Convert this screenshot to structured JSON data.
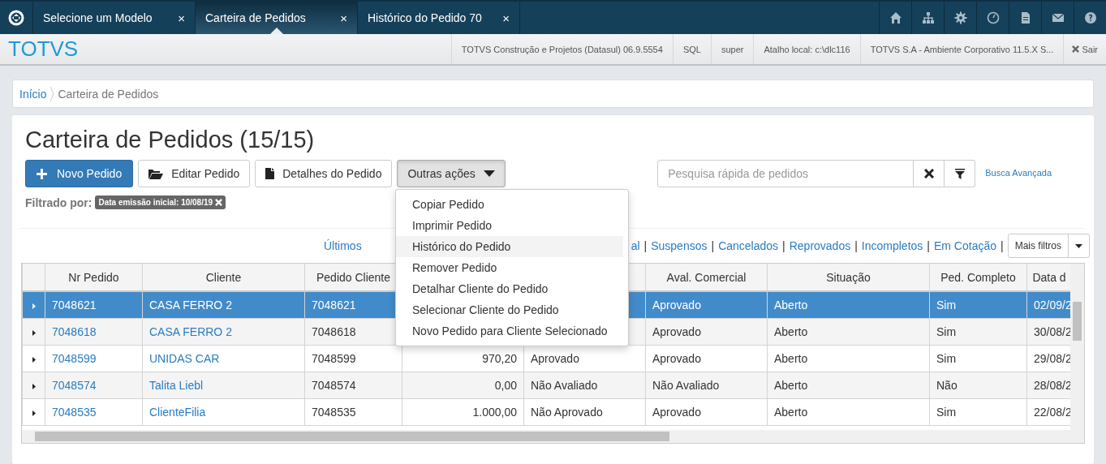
{
  "tabs": [
    {
      "label": "Selecione um Modelo",
      "close": "×",
      "selected": false
    },
    {
      "label": "Carteira de Pedidos",
      "close": "×",
      "selected": true
    },
    {
      "label": "Histórico do Pedido 70",
      "close": "×",
      "selected": false
    }
  ],
  "header": {
    "brand": "TOTVS",
    "info": [
      "TOTVS Construção e Projetos (Datasul) 06.9.5554",
      "SQL",
      "super",
      "Atalho local: c:\\dlc116",
      "TOTVS S.A - Ambiente Corporativo 11.5.X S..."
    ],
    "logout": "Sair"
  },
  "breadcrumb": [
    {
      "label": "Início",
      "kind": "link"
    },
    {
      "label": "Carteira de Pedidos",
      "kind": "current"
    }
  ],
  "title": "Carteira de Pedidos (15/15)",
  "actions": [
    {
      "label": "Novo Pedido",
      "kind": "primary"
    },
    {
      "label": "Editar Pedido",
      "kind": "folder"
    },
    {
      "label": "Detalhes do Pedido",
      "kind": "file"
    },
    {
      "label": "Outras ações",
      "kind": "dropdown",
      "expanded": true
    }
  ],
  "menu": [
    {
      "label": "Copiar Pedido",
      "selected": false
    },
    {
      "label": "Imprimir Pedido",
      "selected": false
    },
    {
      "label": "Histórico do Pedido",
      "selected": true
    },
    {
      "label": "Remover Pedido",
      "selected": false
    },
    {
      "label": "Detalhar Cliente do Pedido",
      "selected": false
    },
    {
      "label": "Selecionar Cliente do Pedido",
      "selected": false
    },
    {
      "label": "Novo Pedido para Cliente Selecionado",
      "selected": false
    }
  ],
  "search": {
    "placeholder": "Pesquisa rápida de pedidos",
    "advanced": "Busca Avançada"
  },
  "filter": {
    "label": "Filtrado por:",
    "tag": "Data emissão inicial: 10/08/19"
  },
  "quick_filters": [
    {
      "label": "Últimos"
    },
    {
      "label": "al",
      "separator": "|"
    },
    {
      "label": "Suspensos",
      "separator": "|"
    },
    {
      "label": "Cancelados",
      "separator": "|"
    },
    {
      "label": "Reprovados",
      "separator": "|"
    },
    {
      "label": "Incompletos",
      "separator": "|"
    },
    {
      "label": "Em Cotação",
      "separator": "|"
    }
  ],
  "more_filters": "Mais filtros",
  "table": {
    "columns": [
      {
        "label": "Nr Pedido",
        "kind": "link"
      },
      {
        "label": "Cliente",
        "kind": "link"
      },
      {
        "label": "Pedido Cliente",
        "kind": "text"
      },
      {
        "kind": "number"
      },
      {
        "kind": "text"
      },
      {
        "label": "Aval. Comercial",
        "kind": "text"
      },
      {
        "label": "Situação",
        "kind": "text"
      },
      {
        "label": "Ped. Completo",
        "kind": "text"
      },
      {
        "label": "Data d",
        "kind": "text"
      }
    ],
    "rows": [
      {
        "selected": true,
        "cells": [
          "7048621",
          "CASA FERRO 2",
          "7048621",
          null,
          null,
          "Aprovado",
          "Aberto",
          "Sim",
          "02/09/2"
        ]
      },
      {
        "selected": false,
        "cells": [
          "7048618",
          "CASA FERRO 2",
          "7048618",
          null,
          null,
          "Aprovado",
          "Aberto",
          "Sim",
          "30/08/2"
        ]
      },
      {
        "selected": false,
        "cells": [
          "7048599",
          "UNIDAS CAR",
          "7048599",
          "970,20",
          "Aprovado",
          "Aprovado",
          "Aberto",
          "Sim",
          "29/08/2"
        ]
      },
      {
        "selected": false,
        "cells": [
          "7048574",
          "Talita Liebl",
          "7048574",
          "0,00",
          "Não Avaliado",
          "Não Avaliado",
          "Aberto",
          "Não",
          "28/08/2"
        ]
      },
      {
        "selected": false,
        "cells": [
          "7048535",
          "ClienteFilia",
          "7048535",
          "1.000,00",
          "Não Aprovado",
          "Aprovado",
          "Aberto",
          "Sim",
          "22/08/2"
        ]
      }
    ]
  }
}
